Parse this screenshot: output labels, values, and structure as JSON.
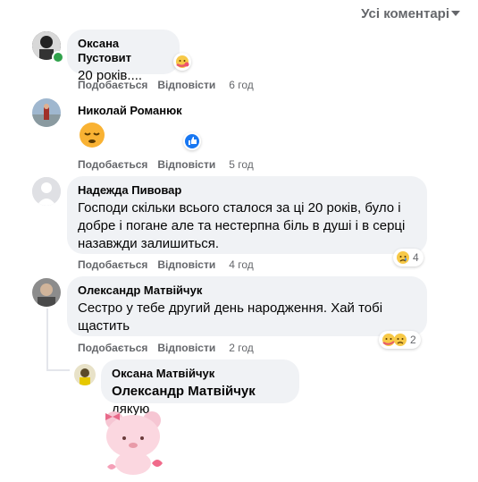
{
  "header": {
    "sort_label": "Усі коментарі"
  },
  "labels": {
    "like": "Подобається",
    "reply": "Відповісти"
  },
  "comments": [
    {
      "name": "Оксана Пустовит",
      "text": "20 років....",
      "time": "6 год"
    },
    {
      "name": "Николай Романюк",
      "text": "",
      "time": "5 год"
    },
    {
      "name": "Надежда Пивовар",
      "text": "Господи скільки всього сталося за ці 20 років, було і добре і погане але та нестерпна біль в душі і в серці назавжди залишиться.",
      "time": "4 год",
      "reaction_count": "4"
    },
    {
      "name": "Олександр Матвійчук",
      "text": "Сестро у тебе другий день народження. Хай тобі щастить",
      "time": "2 год",
      "reaction_count": "2"
    }
  ],
  "reply": {
    "name": "Оксана Матвійчук",
    "mention": "Олександр Матвійчук",
    "text": "дякую"
  }
}
